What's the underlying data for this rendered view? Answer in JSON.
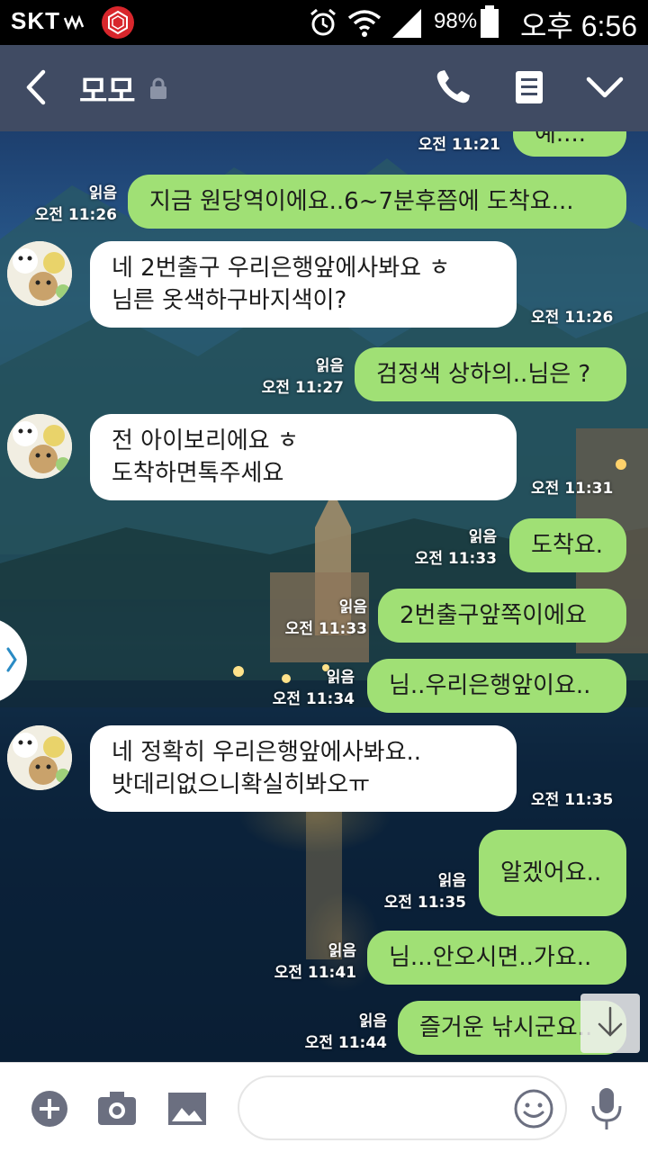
{
  "status_bar": {
    "carrier": "SKT",
    "battery": "98%",
    "time": "오후 6:56"
  },
  "header": {
    "title": "모모",
    "icons": [
      "back-arrow-icon",
      "lock-icon",
      "phone-icon",
      "notes-icon",
      "chevron-down-icon"
    ]
  },
  "messages": [
    {
      "dir": "out",
      "text": "예....",
      "read": "",
      "time": "오전 11:21"
    },
    {
      "dir": "out",
      "text": "지금 원당역이에요..6~7분후쯤에 도착요...",
      "read": "읽음",
      "time": "오전 11:26"
    },
    {
      "dir": "in",
      "lines": [
        "네 2번출구 우리은행앞에사봐요 ㅎ",
        "님른 옷색하구바지색이?"
      ],
      "time": "오전 11:26"
    },
    {
      "dir": "out",
      "text": "검정색 상하의..님은 ?",
      "read": "읽음",
      "time": "오전 11:27"
    },
    {
      "dir": "in",
      "lines": [
        "전 아이보리에요 ㅎ",
        "도착하면톡주세요"
      ],
      "time": "오전 11:31"
    },
    {
      "dir": "out",
      "text": "도착요.",
      "read": "읽음",
      "time": "오전 11:33"
    },
    {
      "dir": "out",
      "text": "2번출구앞쪽이에요",
      "read": "읽음",
      "time": "오전 11:33"
    },
    {
      "dir": "out",
      "text": "님..우리은행앞이요..",
      "read": "읽음",
      "time": "오전 11:34"
    },
    {
      "dir": "in",
      "lines": [
        "네 정확히 우리은행앞에사봐요..",
        "밧데리없으니확실히봐오ㅠ"
      ],
      "time": "오전 11:35"
    },
    {
      "dir": "out",
      "text": "알겠어요..",
      "read": "읽음",
      "time": "오전 11:35"
    },
    {
      "dir": "out",
      "text": "님...안오시면..가요..",
      "read": "읽음",
      "time": "오전 11:41"
    },
    {
      "dir": "out",
      "text": "즐거운 낚시군요..",
      "read": "읽음",
      "time": "오전 11:44"
    }
  ],
  "input": {
    "placeholder": "",
    "icons": [
      "plus-icon",
      "camera-icon",
      "image-icon",
      "emoji-icon",
      "microphone-icon"
    ]
  },
  "colors": {
    "status_bar": "#000000",
    "header": "#404b63",
    "bubble_out": "#a0e075",
    "bubble_in": "#ffffff",
    "icon_gray": "#6b6f80"
  }
}
